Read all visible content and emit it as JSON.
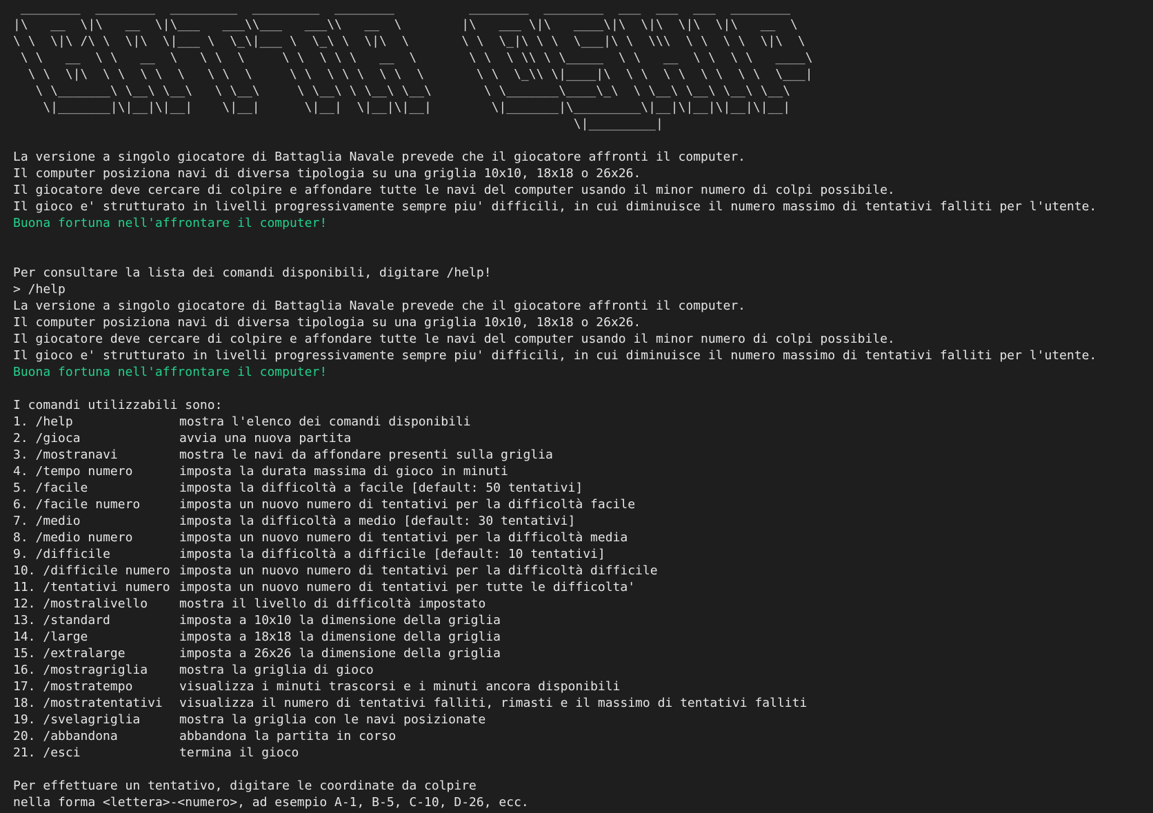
{
  "banner_ascii": [
    " ________  ________  _________  _________  ________          ________  ________  ___  ___  ___  ________",
    "|\\   __  \\|\\   __  \\|\\___   ___\\\\___   ___\\\\   __  \\        |\\   ___ \\|\\   ____\\|\\  \\|\\  \\|\\  \\|\\   __  \\",
    "\\ \\  \\|\\ /\\ \\  \\|\\  \\|___ \\  \\_\\|___ \\  \\_\\ \\  \\|\\  \\       \\ \\  \\_|\\ \\ \\  \\___|\\ \\  \\\\\\  \\ \\  \\ \\  \\|\\  \\",
    " \\ \\   __  \\ \\   __  \\   \\ \\  \\     \\ \\  \\ \\ \\   __  \\       \\ \\  \\ \\\\ \\ \\_____  \\ \\   __  \\ \\  \\ \\   ____\\",
    "  \\ \\  \\|\\  \\ \\  \\ \\  \\   \\ \\  \\     \\ \\  \\ \\ \\  \\ \\  \\       \\ \\  \\_\\\\ \\|____|\\  \\ \\  \\ \\  \\ \\  \\ \\  \\___|",
    "   \\ \\_______\\ \\__\\ \\__\\   \\ \\__\\     \\ \\__\\ \\ \\__\\ \\__\\       \\ \\_______\\____\\_\\  \\ \\__\\ \\__\\ \\__\\ \\__\\",
    "    \\|_______|\\|__|\\|__|    \\|__|      \\|__|  \\|__|\\|__|        \\|_______|\\_________\\|__|\\|__|\\|__|\\|__|",
    "                                                                           \\|_________|"
  ],
  "intro": {
    "lines": [
      "La versione a singolo giocatore di Battaglia Navale prevede che il giocatore affronti il computer.",
      "Il computer posiziona navi di diversa tipologia su una griglia 10x10, 18x18 o 26x26.",
      "Il giocatore deve cercare di colpire e affondare tutte le navi del computer usando il minor numero di colpi possibile.",
      "Il gioco e' strutturato in livelli progressivamente sempre piu' difficili, in cui diminuisce il numero massimo di tentativi falliti per l'utente."
    ],
    "good_luck": "Buona fortuna nell'affrontare il computer!"
  },
  "help_hint": "Per consultare la lista dei comandi disponibili, digitare /help!",
  "prompt_input": "> /help",
  "help_output": {
    "lines": [
      "La versione a singolo giocatore di Battaglia Navale prevede che il giocatore affronti il computer.",
      "Il computer posiziona navi di diversa tipologia su una griglia 10x10, 18x18 o 26x26.",
      "Il giocatore deve cercare di colpire e affondare tutte le navi del computer usando il minor numero di colpi possibile.",
      "Il gioco e' strutturato in livelli progressivamente sempre piu' difficili, in cui diminuisce il numero massimo di tentativi falliti per l'utente."
    ],
    "good_luck": "Buona fortuna nell'affrontare il computer!",
    "commands_header": "I comandi utilizzabili sono:",
    "commands": [
      {
        "num": "1.",
        "cmd": "/help",
        "desc": "mostra l'elenco dei comandi disponibili"
      },
      {
        "num": "2.",
        "cmd": "/gioca",
        "desc": "avvia una nuova partita"
      },
      {
        "num": "3.",
        "cmd": "/mostranavi",
        "desc": "mostra le navi da affondare presenti sulla griglia"
      },
      {
        "num": "4.",
        "cmd": "/tempo numero",
        "desc": "imposta la durata massima di gioco in minuti"
      },
      {
        "num": "5.",
        "cmd": "/facile",
        "desc": "imposta la difficoltà a facile [default: 50 tentativi]"
      },
      {
        "num": "6.",
        "cmd": "/facile numero",
        "desc": "imposta un nuovo numero di tentativi per la difficoltà facile"
      },
      {
        "num": "7.",
        "cmd": "/medio",
        "desc": "imposta la difficoltà a medio [default: 30 tentativi]"
      },
      {
        "num": "8.",
        "cmd": "/medio numero",
        "desc": "imposta un nuovo numero di tentativi per la difficoltà media"
      },
      {
        "num": "9.",
        "cmd": "/difficile",
        "desc": "imposta la difficoltà a difficile [default: 10 tentativi]"
      },
      {
        "num": "10.",
        "cmd": "/difficile numero",
        "desc": "imposta un nuovo numero di tentativi per la difficoltà difficile"
      },
      {
        "num": "11.",
        "cmd": "/tentativi numero",
        "desc": "imposta un nuovo numero di tentativi per tutte le difficolta'"
      },
      {
        "num": "12.",
        "cmd": "/mostralivello",
        "desc": "mostra il livello di difficoltà impostato"
      },
      {
        "num": "13.",
        "cmd": "/standard",
        "desc": "imposta a 10x10 la dimensione della griglia"
      },
      {
        "num": "14.",
        "cmd": "/large",
        "desc": "imposta a 18x18 la dimensione della griglia"
      },
      {
        "num": "15.",
        "cmd": "/extralarge",
        "desc": "imposta a 26x26 la dimensione della griglia"
      },
      {
        "num": "16.",
        "cmd": "/mostragriglia",
        "desc": "mostra la griglia di gioco"
      },
      {
        "num": "17.",
        "cmd": "/mostratempo",
        "desc": "visualizza i minuti trascorsi e i minuti ancora disponibili"
      },
      {
        "num": "18.",
        "cmd": "/mostratentativi",
        "desc": "visualizza il numero di tentativi falliti, rimasti e il massimo di tentativi falliti"
      },
      {
        "num": "19.",
        "cmd": "/svelagriglia",
        "desc": "mostra la griglia con le navi posizionate"
      },
      {
        "num": "20.",
        "cmd": "/abbandona",
        "desc": "abbandona la partita in corso"
      },
      {
        "num": "21.",
        "cmd": "/esci",
        "desc": "termina il gioco"
      }
    ],
    "attempt_instructions": [
      "Per effettuare un tentativo, digitare le coordinate da colpire",
      "nella forma <lettera>-<numero>, ad esempio A-1, B-5, C-10, D-26, ecc."
    ]
  },
  "colors": {
    "background": "#1e1e1e",
    "foreground": "#e6e6e6",
    "accent_green": "#23d18b"
  }
}
